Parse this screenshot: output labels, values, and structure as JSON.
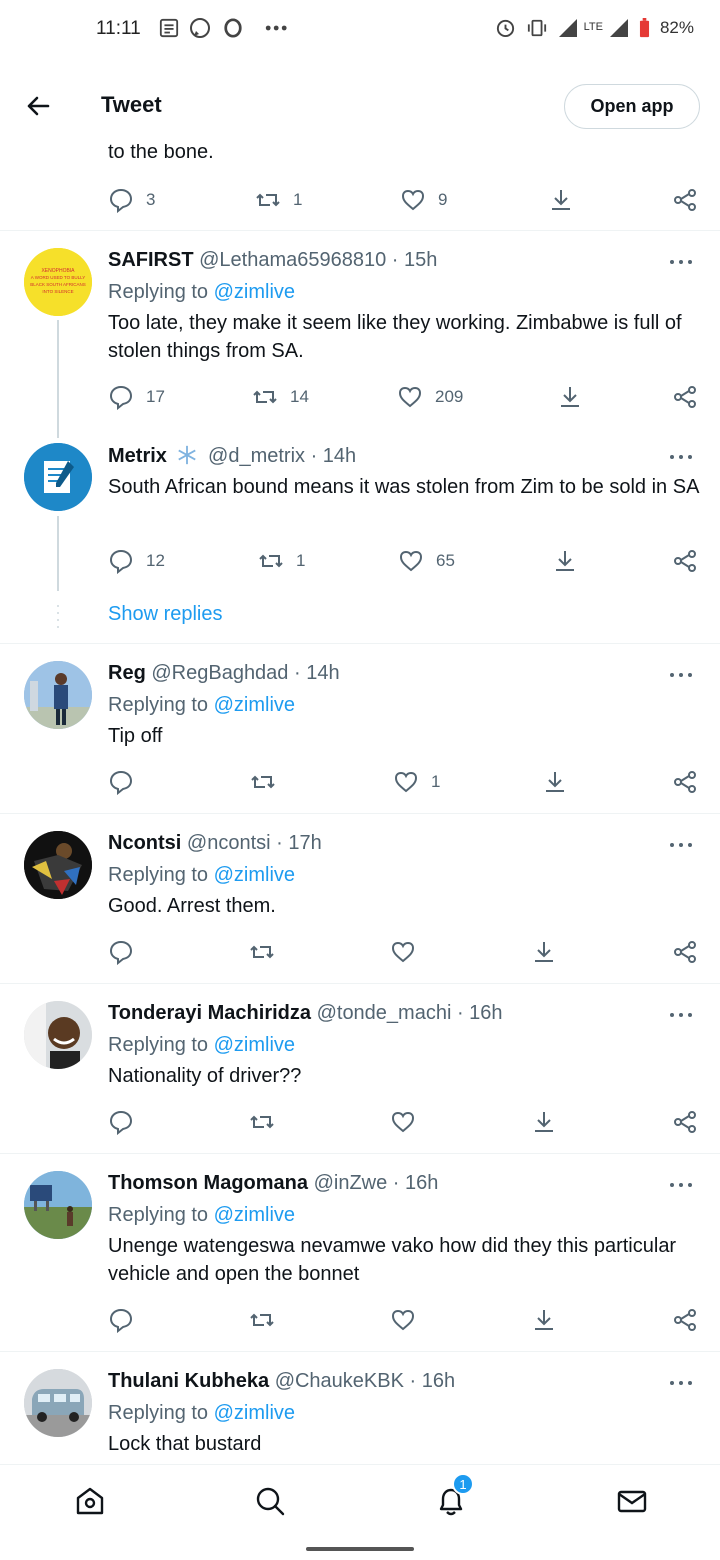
{
  "status_bar": {
    "time": "11:11",
    "lte": "LTE",
    "battery": "82%"
  },
  "header": {
    "title": "Tweet",
    "open_app": "Open app"
  },
  "prev_tweet": {
    "tail_text": "to the bone.",
    "replies": "3",
    "retweets": "1",
    "likes": "9"
  },
  "tweets": [
    {
      "name": "SAFIRST",
      "handle": "@Lethama65968810 · 15h",
      "replying_prefix": "Replying to ",
      "replying_to": "@zimlive",
      "text": "Too late, they make it seem like they working. Zimbabwe is full of stolen things from SA.",
      "replies": "17",
      "retweets": "14",
      "likes": "209"
    },
    {
      "name": "Metrix",
      "handle": "@d_metrix · 14h",
      "text": "South African bound means it was stolen from Zim to be sold in SA",
      "replies": "12",
      "retweets": "1",
      "likes": "65"
    },
    {
      "name": "Reg",
      "handle": "@RegBaghdad · 14h",
      "replying_prefix": "Replying to ",
      "replying_to": "@zimlive",
      "text": "Tip off",
      "replies": "",
      "retweets": "",
      "likes": "1"
    },
    {
      "name": "Ncontsi",
      "handle": "@ncontsi · 17h",
      "replying_prefix": "Replying to ",
      "replying_to": "@zimlive",
      "text": "Good. Arrest them.",
      "replies": "",
      "retweets": "",
      "likes": ""
    },
    {
      "name": "Tonderayi Machiridza",
      "handle": "@tonde_machi · 16h",
      "replying_prefix": "Replying to ",
      "replying_to": "@zimlive",
      "text": "Nationality of driver??",
      "replies": "",
      "retweets": "",
      "likes": ""
    },
    {
      "name": "Thomson Magomana",
      "handle": "@inZwe · 16h",
      "replying_prefix": "Replying to ",
      "replying_to": "@zimlive",
      "text": "Unenge watengeswa nevamwe vako how did they this particular vehicle and open the bonnet",
      "replies": "",
      "retweets": "",
      "likes": ""
    },
    {
      "name": "Thulani Kubheka",
      "handle": "@ChaukeKBK · 16h",
      "replying_prefix": "Replying to ",
      "replying_to": "@zimlive",
      "text": "Lock that bustard"
    }
  ],
  "show_replies": "Show replies",
  "avatar_texts": {
    "safirst": [
      "XENOPHOBIA",
      "A WORD USED TO BULLY",
      "BLACK SOUTH AFRICANS",
      "INTO SILENCE"
    ]
  },
  "bottom_nav": {
    "notifications_badge": "1"
  },
  "colors": {
    "accent": "#1d9bf0",
    "text": "#0f1419",
    "muted": "#536471"
  }
}
